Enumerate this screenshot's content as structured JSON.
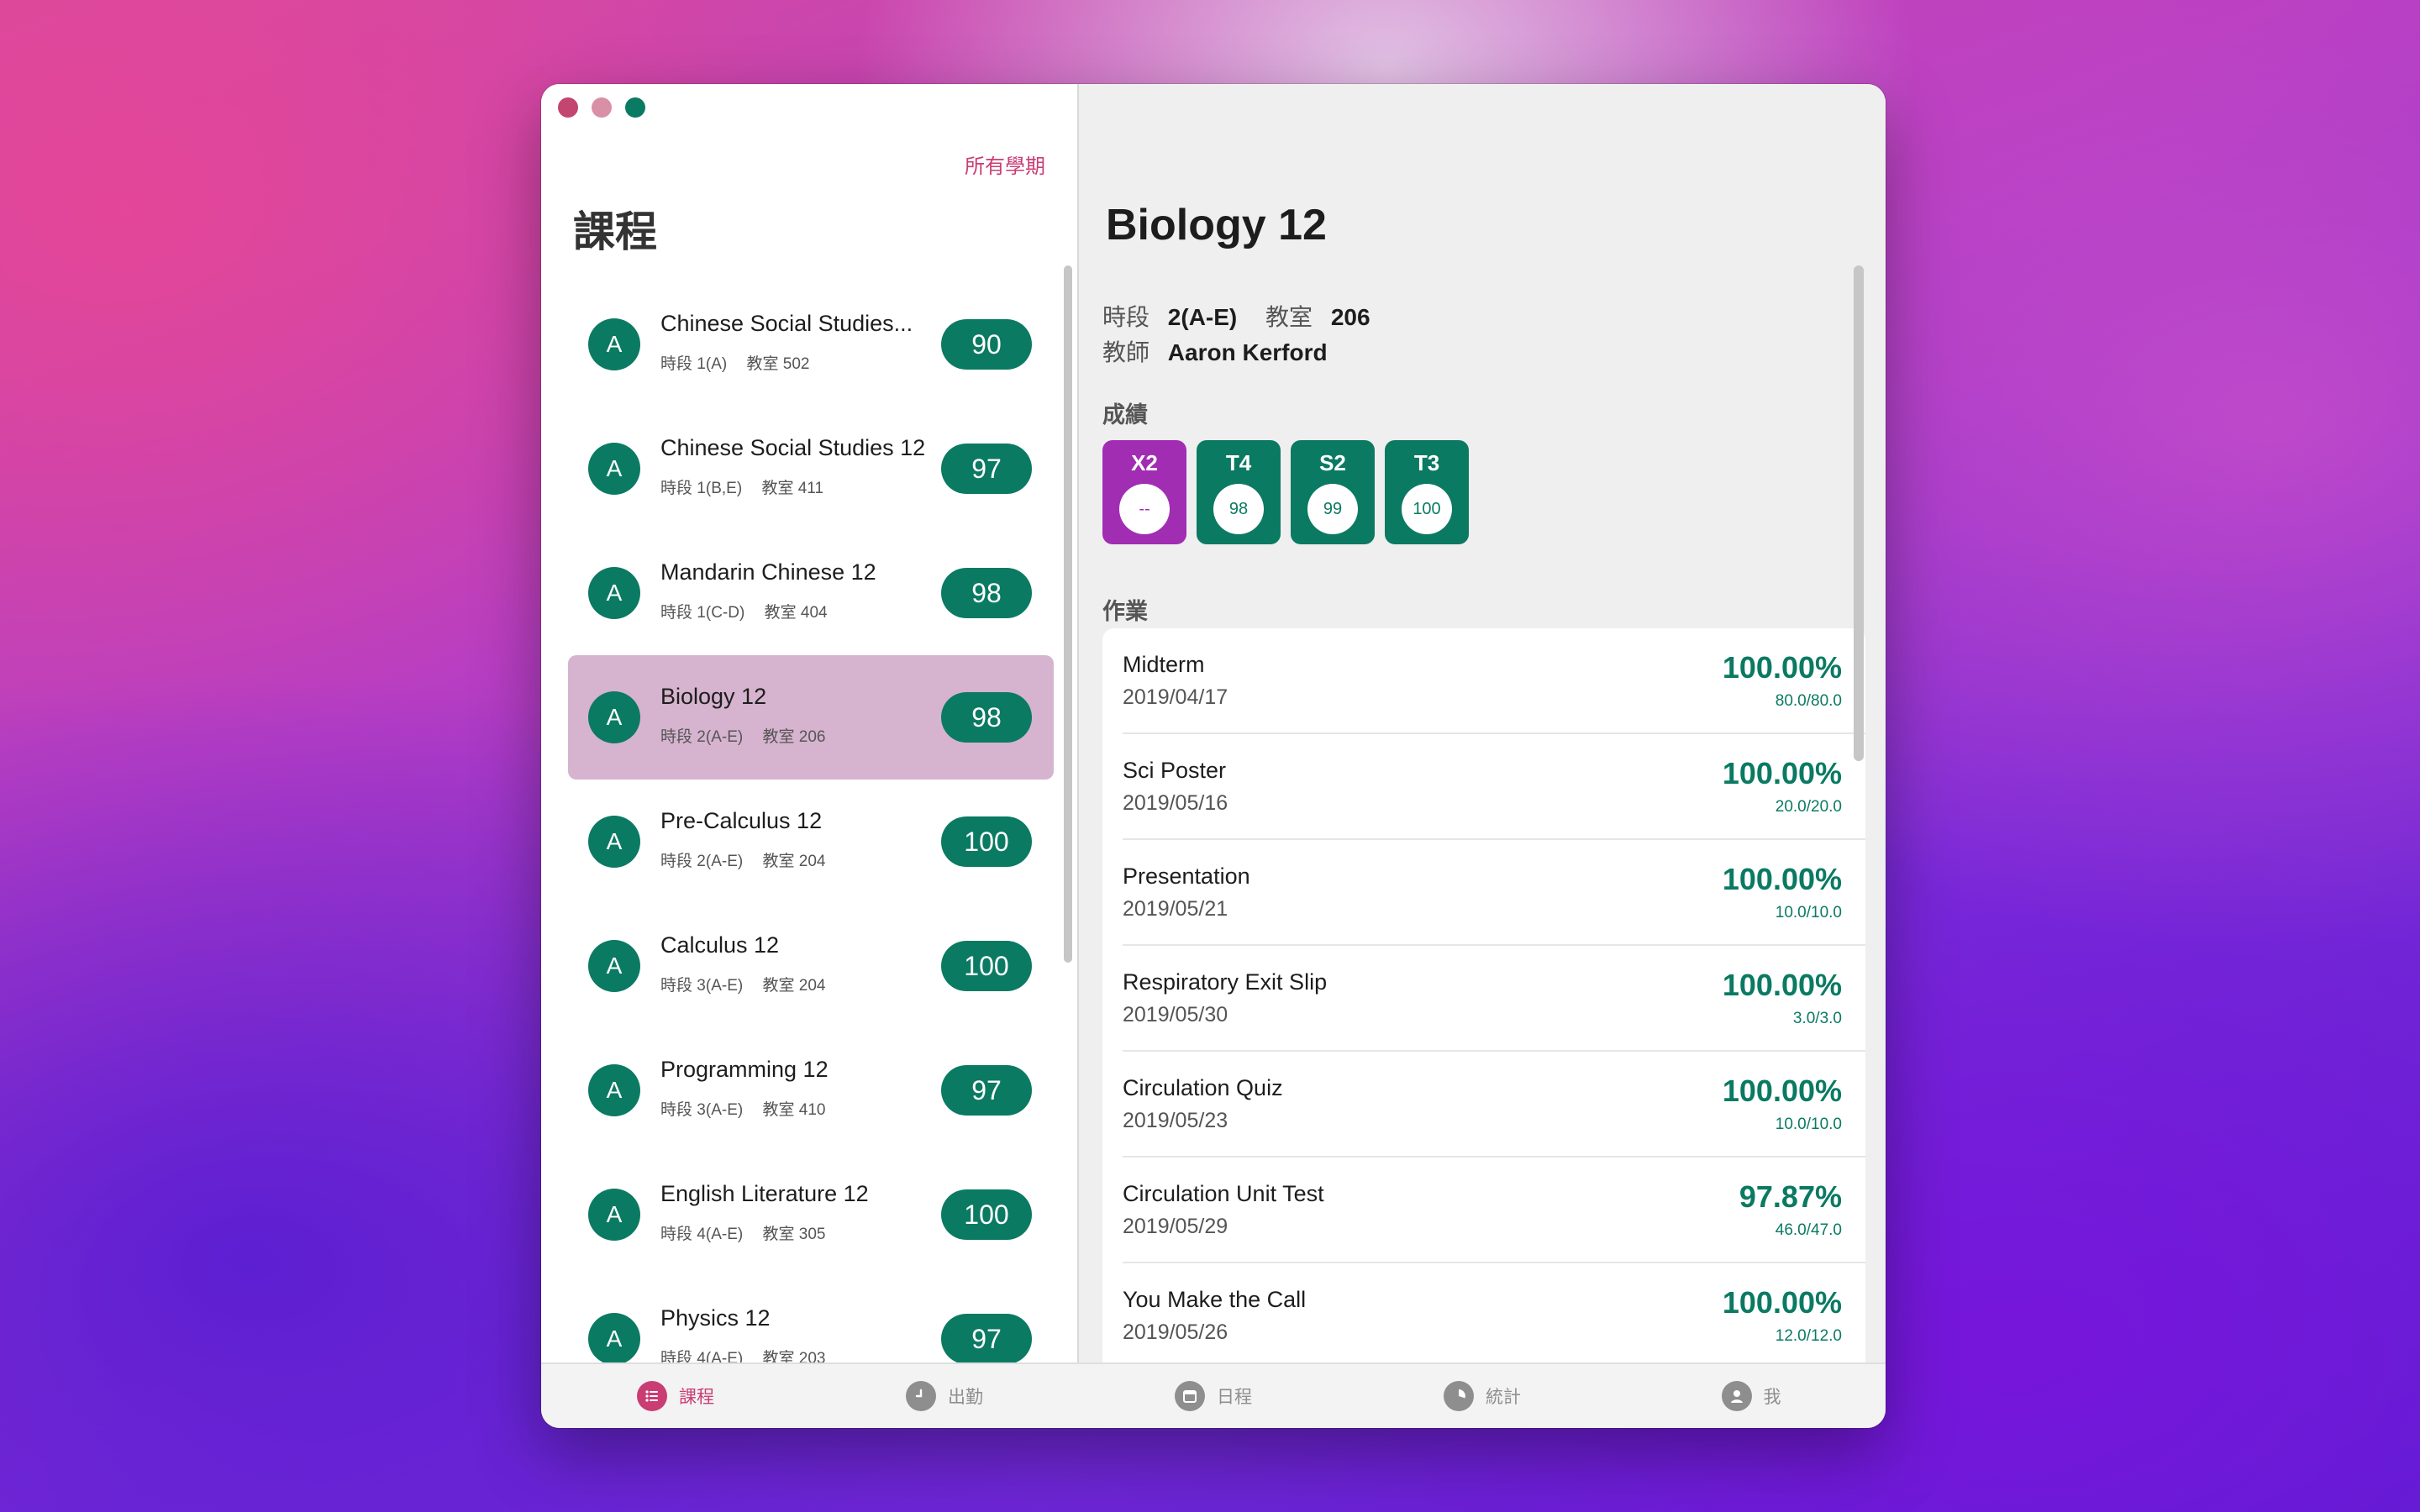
{
  "sidebar": {
    "all_terms_label": "所有學期",
    "title": "課程",
    "courses": [
      {
        "avatar": "A",
        "name": "Chinese Social Studies...",
        "block_label": "時段",
        "block": "1(A)",
        "room_label": "教室",
        "room": "502",
        "grade": "90",
        "selected": false
      },
      {
        "avatar": "A",
        "name": "Chinese Social Studies 12",
        "block_label": "時段",
        "block": "1(B,E)",
        "room_label": "教室",
        "room": "411",
        "grade": "97",
        "selected": false
      },
      {
        "avatar": "A",
        "name": "Mandarin Chinese 12",
        "block_label": "時段",
        "block": "1(C-D)",
        "room_label": "教室",
        "room": "404",
        "grade": "98",
        "selected": false
      },
      {
        "avatar": "A",
        "name": "Biology 12",
        "block_label": "時段",
        "block": "2(A-E)",
        "room_label": "教室",
        "room": "206",
        "grade": "98",
        "selected": true
      },
      {
        "avatar": "A",
        "name": "Pre-Calculus 12",
        "block_label": "時段",
        "block": "2(A-E)",
        "room_label": "教室",
        "room": "204",
        "grade": "100",
        "selected": false
      },
      {
        "avatar": "A",
        "name": "Calculus 12",
        "block_label": "時段",
        "block": "3(A-E)",
        "room_label": "教室",
        "room": "204",
        "grade": "100",
        "selected": false
      },
      {
        "avatar": "A",
        "name": "Programming 12",
        "block_label": "時段",
        "block": "3(A-E)",
        "room_label": "教室",
        "room": "410",
        "grade": "97",
        "selected": false
      },
      {
        "avatar": "A",
        "name": "English Literature 12",
        "block_label": "時段",
        "block": "4(A-E)",
        "room_label": "教室",
        "room": "305",
        "grade": "100",
        "selected": false
      },
      {
        "avatar": "A",
        "name": "Physics 12",
        "block_label": "時段",
        "block": "4(A-E)",
        "room_label": "教室",
        "room": "203",
        "grade": "97",
        "selected": false
      }
    ]
  },
  "detail": {
    "title": "Biology 12",
    "block_label": "時段",
    "block": "2(A-E)",
    "room_label": "教室",
    "room": "206",
    "teacher_label": "教師",
    "teacher": "Aaron Kerford",
    "grades_label": "成績",
    "terms": [
      {
        "label": "X2",
        "value": "--",
        "active": true
      },
      {
        "label": "T4",
        "value": "98",
        "active": false
      },
      {
        "label": "S2",
        "value": "99",
        "active": false
      },
      {
        "label": "T3",
        "value": "100",
        "active": false
      }
    ],
    "assignments_label": "作業",
    "assignments": [
      {
        "name": "Midterm",
        "date": "2019/04/17",
        "percent": "100.00%",
        "score": "80.0/80.0"
      },
      {
        "name": "Sci Poster",
        "date": "2019/05/16",
        "percent": "100.00%",
        "score": "20.0/20.0"
      },
      {
        "name": "Presentation",
        "date": "2019/05/21",
        "percent": "100.00%",
        "score": "10.0/10.0"
      },
      {
        "name": "Respiratory Exit Slip",
        "date": "2019/05/30",
        "percent": "100.00%",
        "score": "3.0/3.0"
      },
      {
        "name": "Circulation Quiz",
        "date": "2019/05/23",
        "percent": "100.00%",
        "score": "10.0/10.0"
      },
      {
        "name": "Circulation Unit Test",
        "date": "2019/05/29",
        "percent": "97.87%",
        "score": "46.0/47.0"
      },
      {
        "name": "You Make the Call",
        "date": "2019/05/26",
        "percent": "100.00%",
        "score": "12.0/12.0"
      }
    ]
  },
  "tabbar": {
    "tabs": [
      {
        "label": "課程",
        "icon": "list-icon",
        "active": true
      },
      {
        "label": "出勤",
        "icon": "clock-icon",
        "active": false
      },
      {
        "label": "日程",
        "icon": "calendar-icon",
        "active": false
      },
      {
        "label": "統計",
        "icon": "pie-chart-icon",
        "active": false
      },
      {
        "label": "我",
        "icon": "person-icon",
        "active": false
      }
    ]
  },
  "colors": {
    "accent": "#c93d74",
    "grade_green": "#0b7a62",
    "selected_row": "#d6b3cf",
    "active_term": "#a12db3"
  }
}
